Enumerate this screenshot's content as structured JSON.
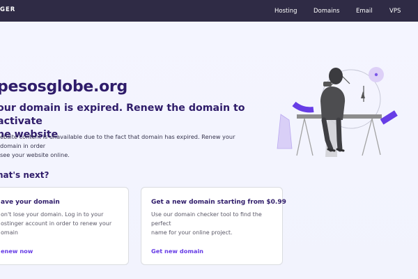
{
  "header": {
    "brand": "GER",
    "nav": [
      "Hosting",
      "Domains",
      "Email",
      "VPS"
    ]
  },
  "main": {
    "domain": "pesosglobe.org",
    "heading": "our domain is expired. Renew the domain to activate he website",
    "heading_lines": [
      "our domain is expired. Renew the domain to activate",
      "he website"
    ],
    "description_lines": [
      "ebsite content is unavailable due to the fact that domain has expired. Renew your domain in order",
      "see your website online."
    ],
    "whats_next": "hat's next?"
  },
  "cards": [
    {
      "title": "ave your domain",
      "text_lines": [
        "on't lose your domain. Log in to your",
        "ostinger account in order to renew your",
        "omain"
      ],
      "link": "enew now"
    },
    {
      "title": "Get a new domain starting from $0.99",
      "text_lines": [
        "Use our domain checker tool to find the perfect",
        "name for your online project."
      ],
      "link": "Get new domain"
    }
  ],
  "colors": {
    "topbar": "#2f2b45",
    "background": "#f4f5ff",
    "heading": "#2f1c6a",
    "accent": "#673de6",
    "card_border": "#dadce0"
  },
  "icons": {
    "illustration": "person-at-desk-illustration"
  }
}
